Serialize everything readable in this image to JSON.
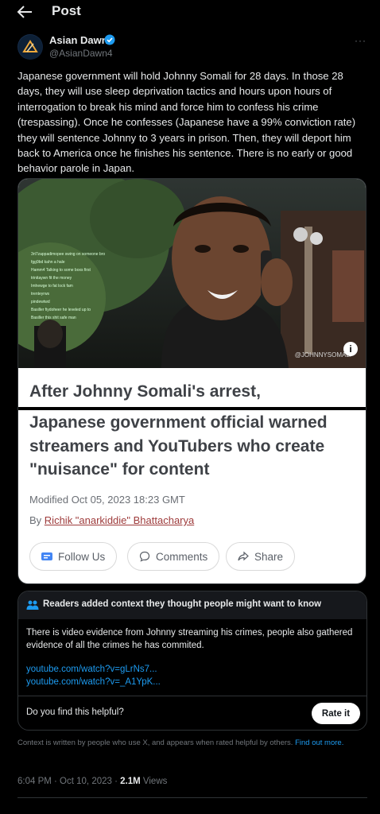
{
  "header": {
    "back_icon": "arrow-left-icon",
    "title": "Post"
  },
  "author": {
    "name": "Asian Dawn",
    "handle": "@AsianDawn4",
    "verified_icon": "verified-badge-icon",
    "more_label": "···"
  },
  "tweet": {
    "text": "Japanese government will hold Johnny Somali for 28 days. In those 28 days, they will use sleep deprivation tactics and hours upon hours of interrogation to break his mind and force him to confess his crime (trespassing). Once he confesses (Japanese have a 99% conviction rate) they will sentence Johnny to 3 years in prison. Then, they will deport him back to America once he finishes his sentence. There is no early or good behavior parole in Japan."
  },
  "media": {
    "video_handle": "@JOHNNYSOMALI",
    "info_label": "i",
    "chat_lines": [
      "3rt7zappadimopee swing on someone bro",
      "fgg9bd kahn a hale",
      "Hamm4 Talking to some boxs first",
      "trinitaywn fit the money",
      "Imhewge to fat lock fam",
      "trenteyrws",
      "pindewtwd",
      "Basiller fiydoheer he leveled up to",
      "Basiller this shit safe man"
    ],
    "article": {
      "headline_top": "After Johnny Somali's arrest,",
      "headline_rest": "Japanese government official warned streamers and YouTubers who create \"nuisance\" for content",
      "modified": "Modified Oct 05, 2023 18:23 GMT",
      "by_prefix": "By",
      "by_author": "Richik \"anarkiddie\" Bhattacharya",
      "follow_label": "Follow Us",
      "comments_label": "Comments",
      "share_label": "Share"
    }
  },
  "community_note": {
    "title": "Readers added context they thought people might want to know",
    "body": "There is video evidence from Johnny streaming his crimes, people also gathered evidence of all the crimes he has commited.",
    "links": [
      "youtube.com/watch?v=gLrNs7...",
      "youtube.com/watch?v=_A1YpK..."
    ],
    "question": "Do you find this helpful?",
    "rate_label": "Rate it"
  },
  "disclaimer": {
    "text": "Context is written by people who use X, and appears when rated helpful by others.",
    "link": "Find out more."
  },
  "meta": {
    "time": "6:04 PM · Oct 10, 2023 ·",
    "views_count": "2.1M",
    "views_label": "Views"
  },
  "colors": {
    "accent": "#1d9bf0",
    "background": "#000000",
    "text": "#e7e9ea",
    "muted": "#71767b"
  }
}
